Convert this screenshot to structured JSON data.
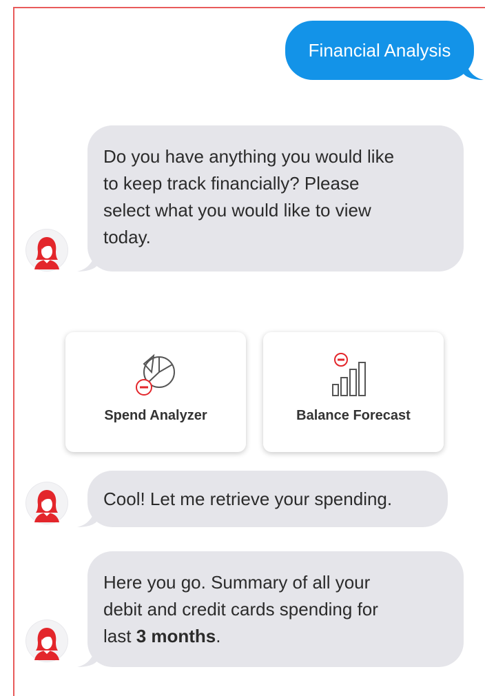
{
  "conversation": {
    "user_message": "Financial Analysis",
    "bot_prompt": {
      "lines": [
        "Do you have anything you would like",
        "to keep track financially? Please",
        "select what you would like to view",
        "today."
      ]
    },
    "options": [
      {
        "label": "Spend Analyzer",
        "icon": "pie-chart-icon"
      },
      {
        "label": "Balance Forecast",
        "icon": "bar-chart-icon"
      }
    ],
    "bot_reply_1": "Cool! Let me retrieve your spending.",
    "bot_reply_2": {
      "line1": "Here you go. Summary of all your",
      "line2": "debit and credit cards spending for",
      "line3_prefix": "last ",
      "line3_bold": "3 months",
      "line3_suffix": "."
    }
  },
  "colors": {
    "user_bubble": "#1393e8",
    "bot_bubble": "#e5e5ea",
    "avatar_red": "#e3262b",
    "frame_border": "#e85a5a"
  }
}
